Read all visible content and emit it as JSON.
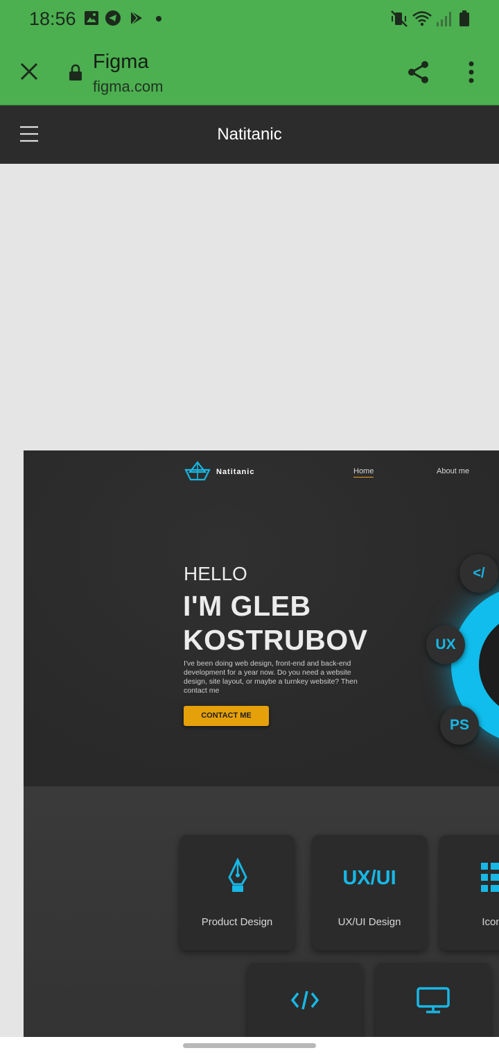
{
  "status_bar": {
    "time": "18:56"
  },
  "toolbar": {
    "title": "Figma",
    "url": "figma.com"
  },
  "figma": {
    "file_title": "Natitanic"
  },
  "site": {
    "logo_text": "Natitanic",
    "nav": {
      "home": "Home",
      "about": "About me"
    },
    "hero": {
      "hello": "HELLO",
      "name_line1": "I'M GLEB",
      "name_line2": "KOSTRUBOV",
      "intro": "I've been doing web design, front-end and back-end development for a year now. Do you need a website design, site layout, or maybe a turnkey website? Then contact me",
      "cta": "CONTACT ME",
      "badges": {
        "code": "</",
        "ux": "UX",
        "ps": "PS"
      }
    },
    "services": [
      {
        "label": "Product Design",
        "icon": "pen-nib-icon"
      },
      {
        "label": "UX/UI Design",
        "icon": "ux-ui-text-icon",
        "icon_text": "UX/UI"
      },
      {
        "label": "Icon D",
        "icon": "grid-list-icon"
      },
      {
        "label": "",
        "icon": "code-icon"
      },
      {
        "label": "",
        "icon": "monitor-icon"
      }
    ]
  },
  "colors": {
    "status_green": "#4caf50",
    "accent_blue": "#10bdec",
    "cta_orange": "#e6a00a",
    "dark_bg": "#2d2d2d"
  }
}
